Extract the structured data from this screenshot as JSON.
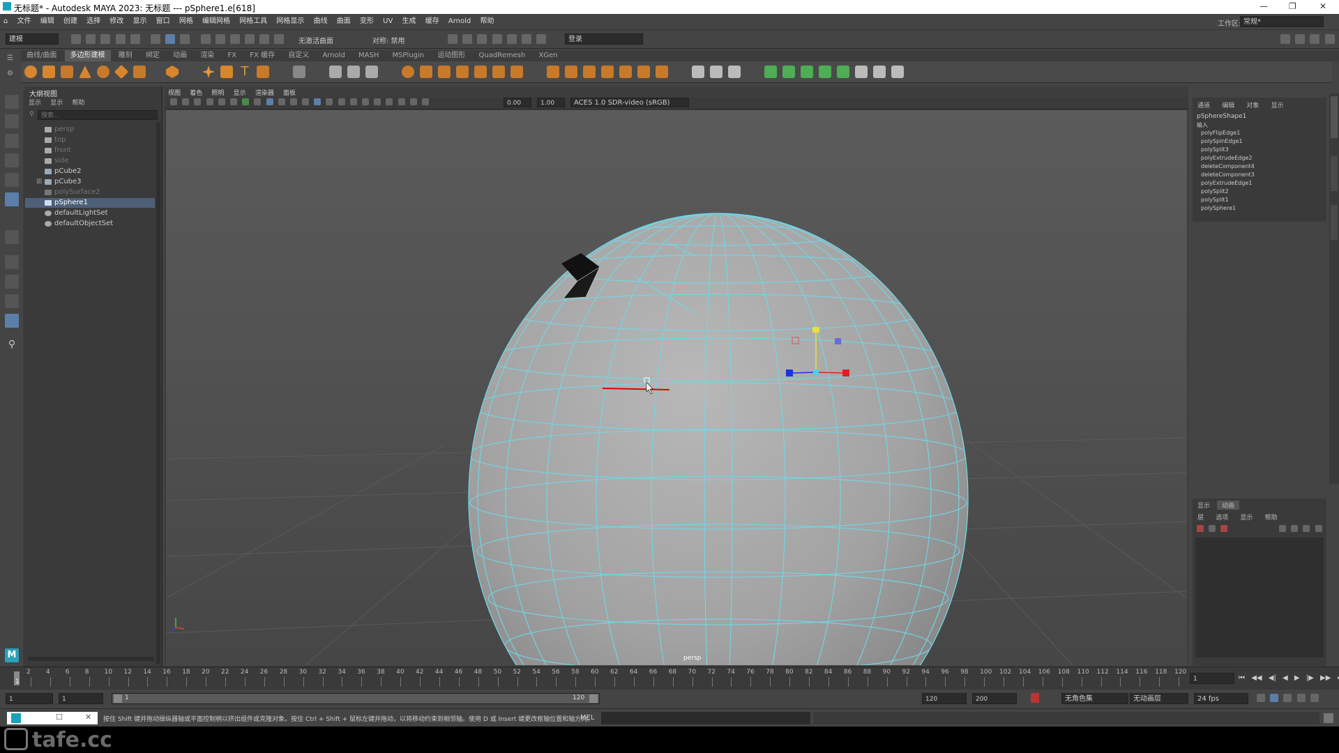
{
  "window": {
    "title": "无标题* - Autodesk MAYA 2023: 无标题   ---   pSphere1.e[618]"
  },
  "menubar": {
    "items": [
      "文件",
      "编辑",
      "创建",
      "选择",
      "修改",
      "显示",
      "窗口",
      "网格",
      "编辑网格",
      "网格工具",
      "网格显示",
      "曲线",
      "曲面",
      "变形",
      "UV",
      "生成",
      "缓存",
      "Arnold",
      "帮助"
    ],
    "workspace_label": "工作区:",
    "workspace_value": "常规*"
  },
  "statusline": {
    "mode": "建模",
    "no_live_surface": "无激活曲面",
    "symmetry": "对称: 禁用",
    "login": "登录"
  },
  "shelf": {
    "tabs": [
      "曲线/曲面",
      "多边形建模",
      "雕刻",
      "绑定",
      "动画",
      "渲染",
      "FX",
      "FX 缓存",
      "自定义",
      "Arnold",
      "MASH",
      "MSPlugin",
      "运动图形",
      "QuadRemesh",
      "XGen"
    ],
    "active_tab": "多边形建模"
  },
  "outliner": {
    "title": "大纲视图",
    "menu": [
      "显示",
      "显示",
      "帮助"
    ],
    "search_placeholder": "搜索...",
    "items": [
      {
        "label": "persp",
        "state": "dim"
      },
      {
        "label": "top",
        "state": "dim"
      },
      {
        "label": "front",
        "state": "dim"
      },
      {
        "label": "side",
        "state": "dim"
      },
      {
        "label": "pCube2",
        "state": "normal"
      },
      {
        "label": "pCube3",
        "state": "normal"
      },
      {
        "label": "polySurface2",
        "state": "dim"
      },
      {
        "label": "pSphere1",
        "state": "selected"
      },
      {
        "label": "defaultLightSet",
        "state": "normal"
      },
      {
        "label": "defaultObjectSet",
        "state": "normal"
      }
    ]
  },
  "viewport": {
    "menu": [
      "视图",
      "着色",
      "照明",
      "显示",
      "渲染器",
      "面板"
    ],
    "exposure": "0.00",
    "gamma": "1.00",
    "colorspace": "ACES 1.0 SDR-video (sRGB)",
    "camera_label": "persp"
  },
  "channel_box": {
    "tabs": [
      "通道",
      "编辑",
      "对象",
      "显示"
    ],
    "shape": "pSphereShape1",
    "inputs_label": "输入",
    "history": [
      "polyFlipEdge1",
      "polySpinEdge1",
      "polySplit3",
      "polyExtrudeEdge2",
      "deleteComponent4",
      "deleteComponent3",
      "polyExtrudeEdge1",
      "polySplit2",
      "polySplit1",
      "polySphere1"
    ]
  },
  "layer_editor": {
    "tabs": [
      "显示",
      "动画"
    ],
    "menu": [
      "层",
      "选项",
      "显示",
      "帮助"
    ]
  },
  "timeline": {
    "ticks": [
      "2",
      "4",
      "6",
      "8",
      "10",
      "12",
      "14",
      "16",
      "18",
      "20",
      "22",
      "24",
      "26",
      "28",
      "30",
      "32",
      "34",
      "36",
      "38",
      "40",
      "42",
      "44",
      "46",
      "48",
      "50",
      "52",
      "54",
      "56",
      "58",
      "60",
      "62",
      "64",
      "66",
      "68",
      "70",
      "72",
      "74",
      "76",
      "78",
      "80",
      "82",
      "84",
      "86",
      "88",
      "90",
      "92",
      "94",
      "96",
      "98",
      "100",
      "102",
      "104",
      "106",
      "108",
      "110",
      "112",
      "114",
      "116",
      "118",
      "120"
    ],
    "current_frame": "1"
  },
  "range": {
    "start": "1",
    "anim_start": "1",
    "range_start": "1",
    "range_end": "120",
    "anim_end": "120",
    "end": "200",
    "char_set": "无角色集",
    "anim_layer": "无动画层",
    "fps": "24 fps"
  },
  "command": {
    "help_text": "按住 Shift 键并拖动操纵器轴或平面控制柄以挤出组件或克隆对象。按住 Ctrl + Shift + 鼠标左键并拖动，以将移动约束到相邻轴。使用 D 或 Insert 键更改枢轴位置和轴方向。",
    "lang": "MEL"
  },
  "watermark": "tafe.cc"
}
